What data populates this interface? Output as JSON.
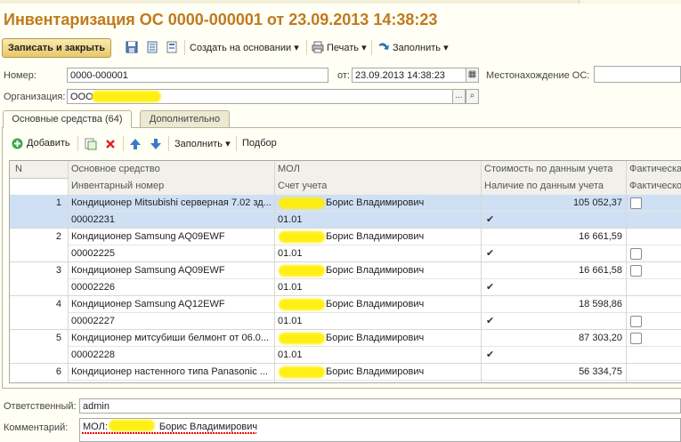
{
  "document": {
    "title": "Инвентаризация ОС 0000-000001 от 23.09.2013 14:38:23"
  },
  "toolbar": {
    "save_close_label": "Записать и закрыть",
    "create_based_label": "Создать на основании",
    "print_label": "Печать",
    "fill_label": "Заполнить"
  },
  "form": {
    "number_label": "Номер:",
    "number_value": "0000-000001",
    "date_label": "от:",
    "date_value": "23.09.2013 14:38:23",
    "location_label": "Местонахождение ОС:",
    "location_value": "",
    "org_label": "Организация:",
    "org_value": "ООО"
  },
  "tabs": {
    "main_label": "Основные средства (64)",
    "extra_label": "Дополнительно"
  },
  "table_toolbar": {
    "add_label": "Добавить",
    "fill_label": "Заполнить",
    "pick_label": "Подбор"
  },
  "table": {
    "headers": {
      "n": "N",
      "asset": "Основное средство",
      "inventory_number": "Инвентарный номер",
      "mol": "МОЛ",
      "account": "Счет учета",
      "cost": "Стоимость по данным учета",
      "presence": "Наличие по данным учета",
      "actual1": "Фактическа",
      "actual2": "Фактическо"
    },
    "rows": [
      {
        "n": "1",
        "asset": "Кондиционер Mitsubishi  серверная 7.02 зд...",
        "inv": "00002231",
        "mol": "Борис Владимирович",
        "account": "01.01",
        "cost": "105 052,37",
        "selected": true
      },
      {
        "n": "2",
        "asset": "Кондиционер Samsung AQ09EWF",
        "inv": "00002225",
        "mol": "Борис Владимирович",
        "account": "01.01",
        "cost": "16 661,59",
        "selected": false
      },
      {
        "n": "3",
        "asset": "Кондиционер Samsung AQ09EWF",
        "inv": "00002226",
        "mol": "Борис Владимирович",
        "account": "01.01",
        "cost": "16 661,58",
        "selected": false
      },
      {
        "n": "4",
        "asset": "Кондиционер Samsung AQ12EWF",
        "inv": "00002227",
        "mol": "Борис Владимирович",
        "account": "01.01",
        "cost": "18 598,86",
        "selected": false
      },
      {
        "n": "5",
        "asset": "Кондиционер митсубиши белмонт от 06.0...",
        "inv": "00002228",
        "mol": "Борис Владимирович",
        "account": "01.01",
        "cost": "87 303,20",
        "selected": false
      },
      {
        "n": "6",
        "asset": "Кондиционер настенного типа  Panasonic ...",
        "inv": "",
        "mol": "Борис Владимирович",
        "account": "",
        "cost": "56 334,75",
        "selected": false
      }
    ]
  },
  "footer": {
    "responsible_label": "Ответственный:",
    "responsible_value": "admin",
    "comment_label": "Комментарий:",
    "comment_prefix": "МОЛ:",
    "comment_name": "Борис Владимирович"
  },
  "colors": {
    "title": "#c07a1c",
    "selected_row": "#cfe0f5",
    "redaction": "#ffee00"
  }
}
